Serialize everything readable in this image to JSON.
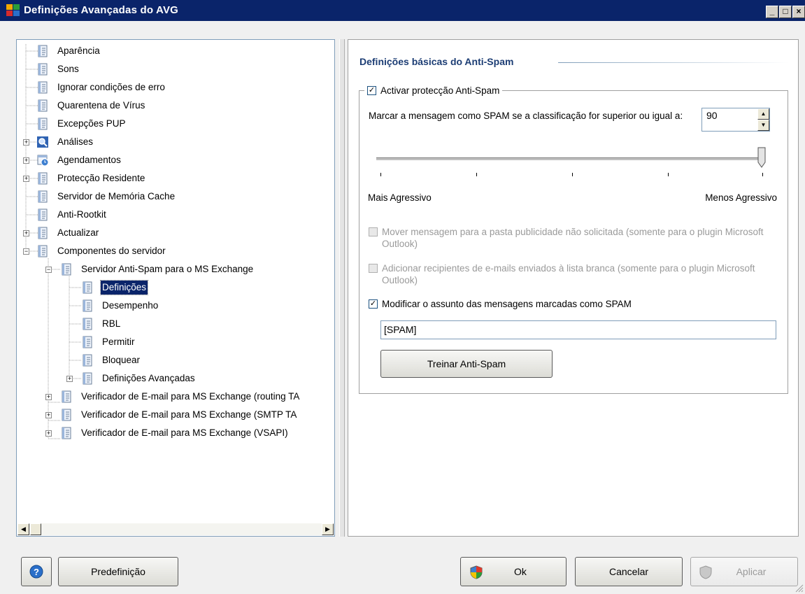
{
  "window": {
    "title": "Definições Avançadas do AVG",
    "minimize_glyph": "_",
    "maximize_glyph": "□",
    "close_glyph": "×"
  },
  "tree": {
    "items": [
      {
        "label": "Aparência"
      },
      {
        "label": "Sons"
      },
      {
        "label": "Ignorar condições de erro"
      },
      {
        "label": "Quarentena de Vírus"
      },
      {
        "label": "Excepções PUP"
      },
      {
        "label": "Análises"
      },
      {
        "label": "Agendamentos"
      },
      {
        "label": "Protecção Residente"
      },
      {
        "label": "Servidor de Memória Cache"
      },
      {
        "label": "Anti-Rootkit"
      },
      {
        "label": "Actualizar"
      },
      {
        "label": "Componentes do servidor"
      },
      {
        "label": "Servidor Anti-Spam para o MS Exchange"
      },
      {
        "label": "Definições"
      },
      {
        "label": "Desempenho"
      },
      {
        "label": "RBL"
      },
      {
        "label": "Permitir"
      },
      {
        "label": "Bloquear"
      },
      {
        "label": "Definições Avançadas"
      },
      {
        "label": "Verificador de E-mail para MS Exchange (routing TA"
      },
      {
        "label": "Verificador de E-mail para MS Exchange (SMTP TA"
      },
      {
        "label": "Verificador de E-mail para MS Exchange (VSAPI)"
      }
    ],
    "selected": "Definições"
  },
  "main": {
    "section_title": "Definições básicas do Anti-Spam",
    "enable_label": "Activar protecção Anti-Spam",
    "enable_checked": true,
    "threshold_label": "Marcar a mensagem como SPAM se a classificação for superior ou igual a:",
    "threshold_value": "90",
    "slider_level": 1.0,
    "slider_min_label": "Mais Agressivo",
    "slider_max_label": "Menos Agressivo",
    "move_label": "Mover mensagem para a pasta publicidade não solicitada (somente para o plugin Microsoft Outlook)",
    "move_checked": false,
    "move_enabled": false,
    "whitelist_label": "Adicionar recipientes de e-mails enviados à lista branca (somente para o plugin Microsoft Outlook)",
    "whitelist_checked": false,
    "whitelist_enabled": false,
    "modify_subject_label": "Modificar o assunto das mensagens marcadas como SPAM",
    "modify_subject_checked": true,
    "subject_value": "[SPAM]",
    "train_button": "Treinar Anti-Spam"
  },
  "footer": {
    "help_glyph": "?",
    "default_button": "Predefinição",
    "ok_button": "Ok",
    "cancel_button": "Cancelar",
    "apply_button": "Aplicar"
  },
  "icons": {
    "app": "avg-app-icon",
    "tree_item": "settings-document-icon",
    "scan": "magnifier-icon",
    "schedule": "calendar-clock-icon",
    "shield": "shield-icon",
    "help": "help-icon",
    "check": "✓"
  },
  "colors": {
    "titlebar": "#0a246a",
    "section_title": "#1c3d74",
    "selection": "#0a246a",
    "help_blue": "#2a6fc9"
  }
}
